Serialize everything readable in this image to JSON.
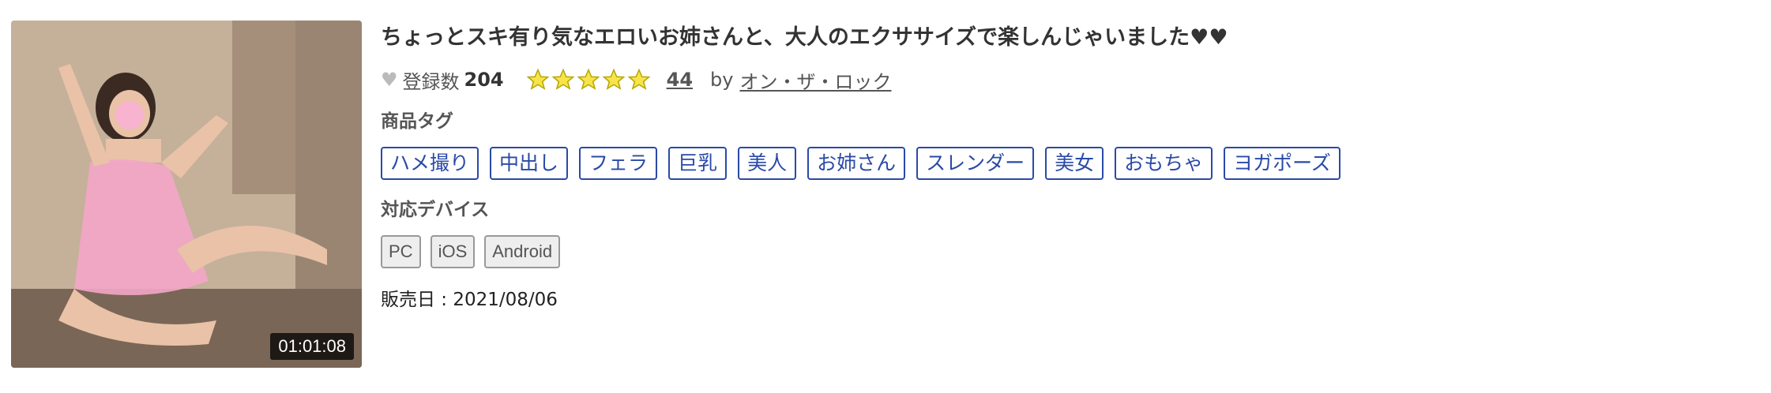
{
  "product": {
    "duration": "01:01:08",
    "title": "ちょっとスキ有り気なエロいお姉さんと、大人のエクササイズで楽しんじゃいました♥♥",
    "favorite_label": "登録数",
    "favorite_count": "204",
    "rating_stars": 5,
    "rating_count": "44",
    "by_label": "by",
    "author": "オン・ザ・ロック",
    "tags_label": "商品タグ",
    "tags": [
      "ハメ撮り",
      "中出し",
      "フェラ",
      "巨乳",
      "美人",
      "お姉さん",
      "スレンダー",
      "美女",
      "おもちゃ",
      "ヨガポーズ"
    ],
    "devices_label": "対応デバイス",
    "devices": [
      "PC",
      "iOS",
      "Android"
    ],
    "release": "販売日 : 2021/08/06"
  },
  "colors": {
    "tag_border": "#2a4aa8",
    "star_fill": "#f7e44a",
    "star_stroke": "#b8a600",
    "thumbnail_background": "#c9b6a0",
    "thumbnail_figure": "#f3a6c8"
  },
  "icons": {
    "favorite": "heart-icon",
    "rating": "star-icon"
  }
}
